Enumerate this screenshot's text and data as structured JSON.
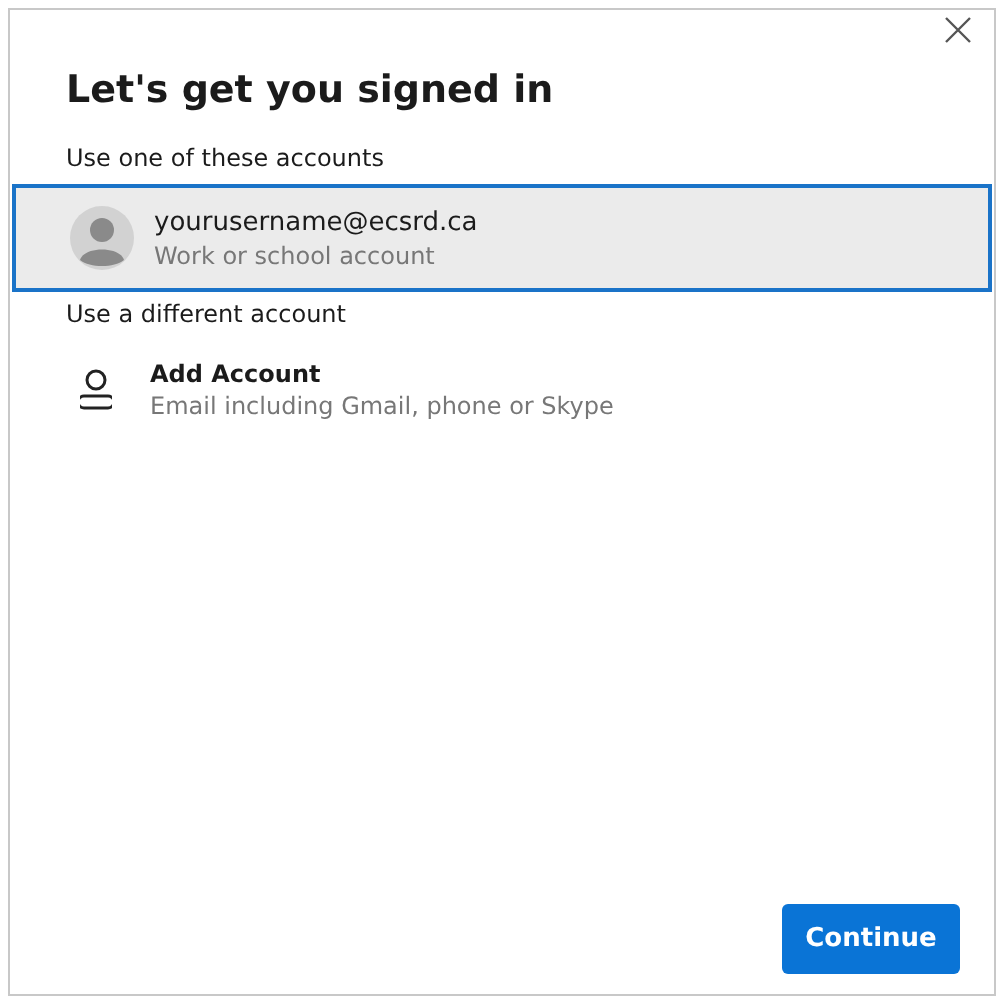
{
  "dialog": {
    "title": "Let's get you signed in"
  },
  "accounts_heading": "Use one of these accounts",
  "accounts": [
    {
      "name": "yourusername@ecsrd.ca",
      "detail": "Work or school account",
      "selected": true
    }
  ],
  "other_heading": "Use a different account",
  "add_account": {
    "name": "Add Account",
    "detail": "Email including Gmail, phone or Skype"
  },
  "buttons": [
    {
      "label": "Continue"
    }
  ]
}
